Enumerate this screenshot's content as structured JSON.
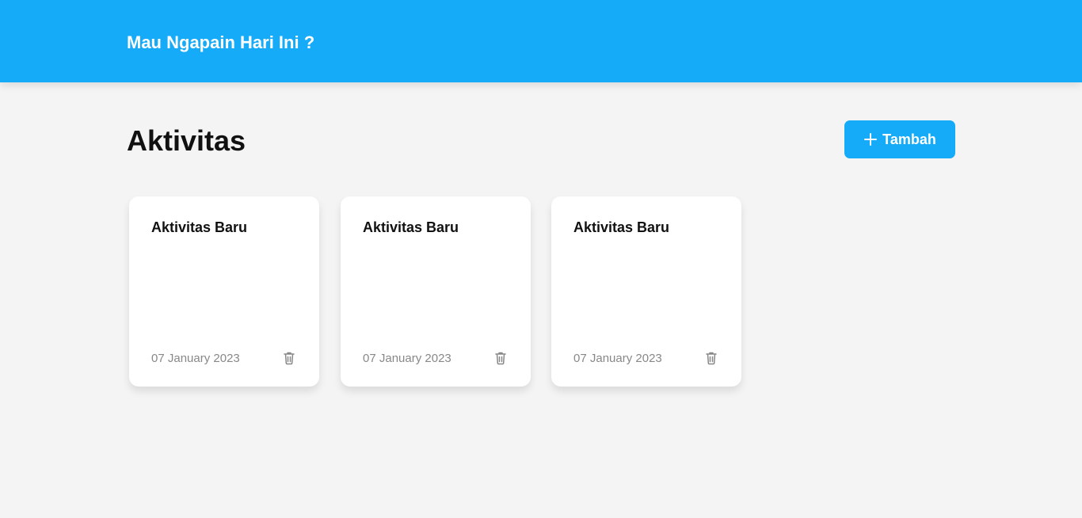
{
  "header": {
    "title": "Mau Ngapain Hari Ini ?",
    "color": "#16abf8"
  },
  "main": {
    "title": "Aktivitas",
    "add_button": {
      "label": "Tambah",
      "icon": "plus-icon",
      "color": "#16abf8"
    },
    "activities": [
      {
        "title": "Aktivitas Baru",
        "date": "07 January 2023",
        "delete_icon": "trash-icon"
      },
      {
        "title": "Aktivitas Baru",
        "date": "07 January 2023",
        "delete_icon": "trash-icon"
      },
      {
        "title": "Aktivitas Baru",
        "date": "07 January 2023",
        "delete_icon": "trash-icon"
      }
    ]
  }
}
